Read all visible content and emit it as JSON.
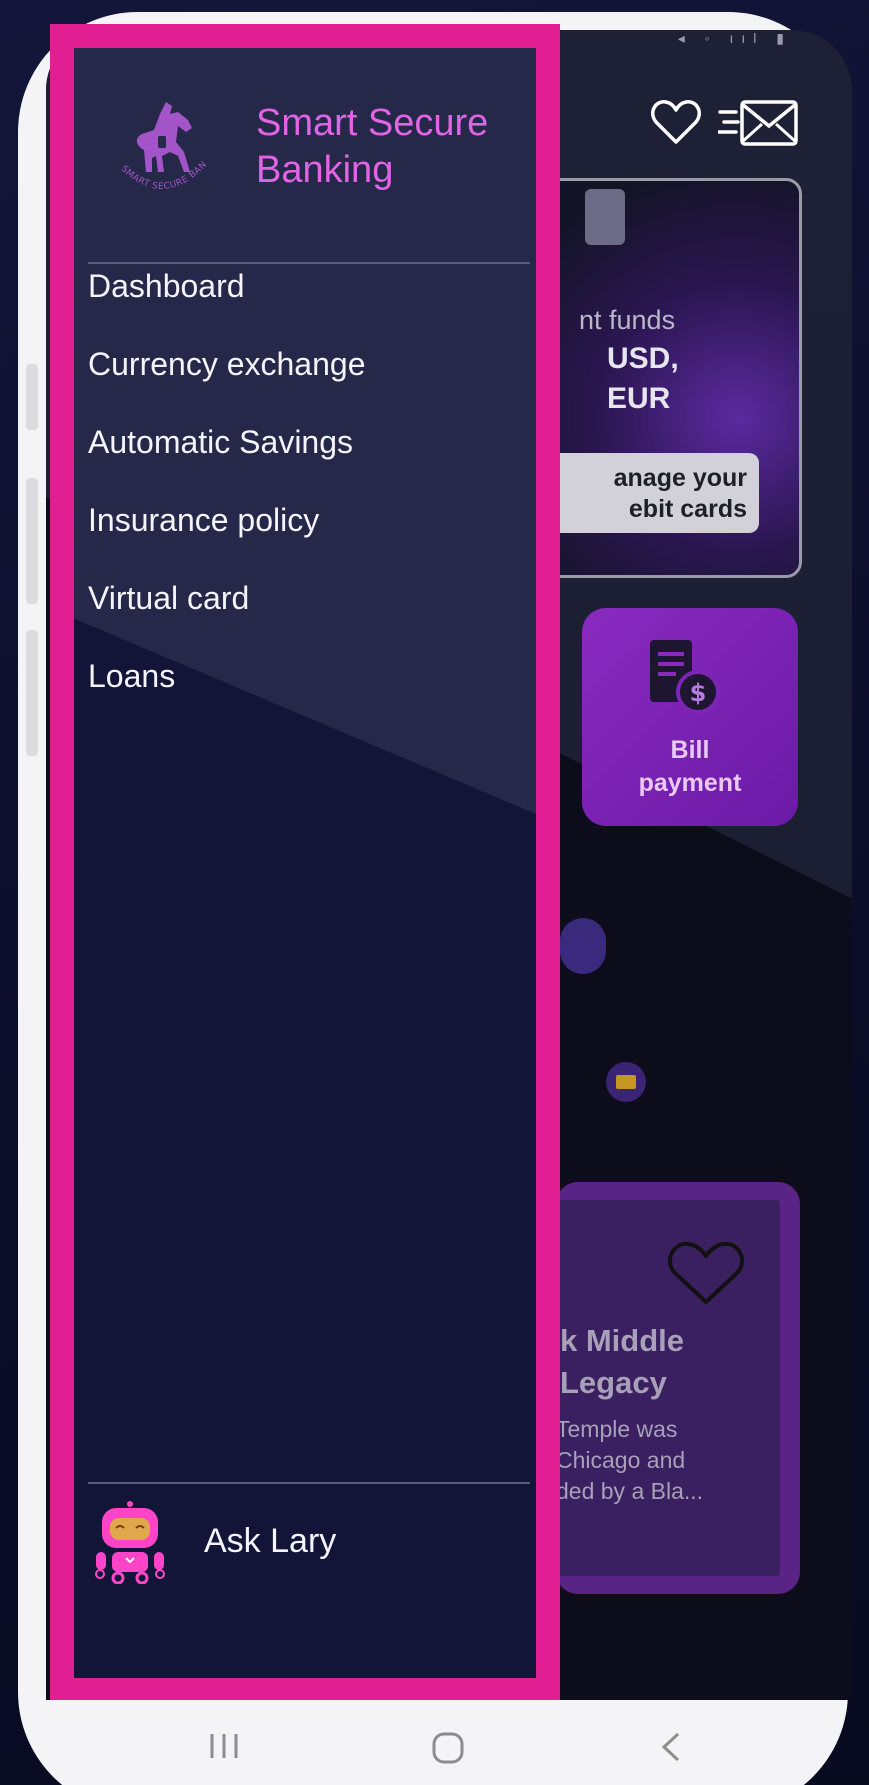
{
  "app": {
    "brand_name": "Smart Secure Banking",
    "logo_text": "SMART SECURE BANKING",
    "accent_color": "#e064e4",
    "highlight_color": "#e11e92"
  },
  "drawer": {
    "menu": [
      {
        "label": "Dashboard"
      },
      {
        "label": "Currency exchange"
      },
      {
        "label": "Automatic Savings"
      },
      {
        "label": "Insurance policy"
      },
      {
        "label": "Virtual card"
      },
      {
        "label": "Loans"
      }
    ],
    "assistant_label": "Ask Lary",
    "assistant_icon": "robot-icon"
  },
  "background": {
    "header_icons": [
      "heart-icon",
      "mail-send-icon"
    ],
    "funds_card": {
      "line1": "nt funds",
      "line2": "USD,",
      "line3": "EUR",
      "button_line1": "anage your",
      "button_line2": "ebit cards"
    },
    "bill_tile": {
      "line1": "Bill",
      "line2": "payment",
      "icon": "bill-dollar-icon"
    },
    "article": {
      "title_line1": "k Middle",
      "title_line2": "Legacy",
      "body_line1": "Temple was",
      "body_line2": "Chicago and",
      "body_line3": "ded by a Bla..."
    }
  }
}
